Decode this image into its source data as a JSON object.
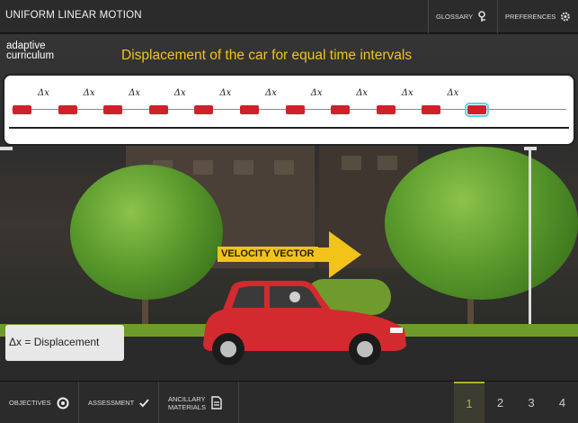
{
  "header": {
    "title": "UNIFORM LINEAR MOTION",
    "glossary_label": "GLOSSARY",
    "preferences_label": "PREFERENCES"
  },
  "stage": {
    "logo_line1": "adaptive",
    "logo_line2": "curriculum",
    "title": "Displacement of the car for equal time intervals",
    "delta_label": "Δx",
    "velocity_label": "VELOCITY VECTOR",
    "legend_label": "Δx = Displacement",
    "interval_count": 10
  },
  "footer": {
    "objectives_label": "OBJECTIVES",
    "assessment_label": "ASSESSMENT",
    "ancillary_line1": "ANCILLARY",
    "ancillary_line2": "MATERIALS",
    "pages": [
      "1",
      "2",
      "3",
      "4"
    ],
    "active_page": "1"
  },
  "colors": {
    "title_yellow": "#f2c319",
    "car_red": "#d0202a",
    "highlight_cyan": "#55d7e8",
    "active_page": "#b8b22a"
  }
}
